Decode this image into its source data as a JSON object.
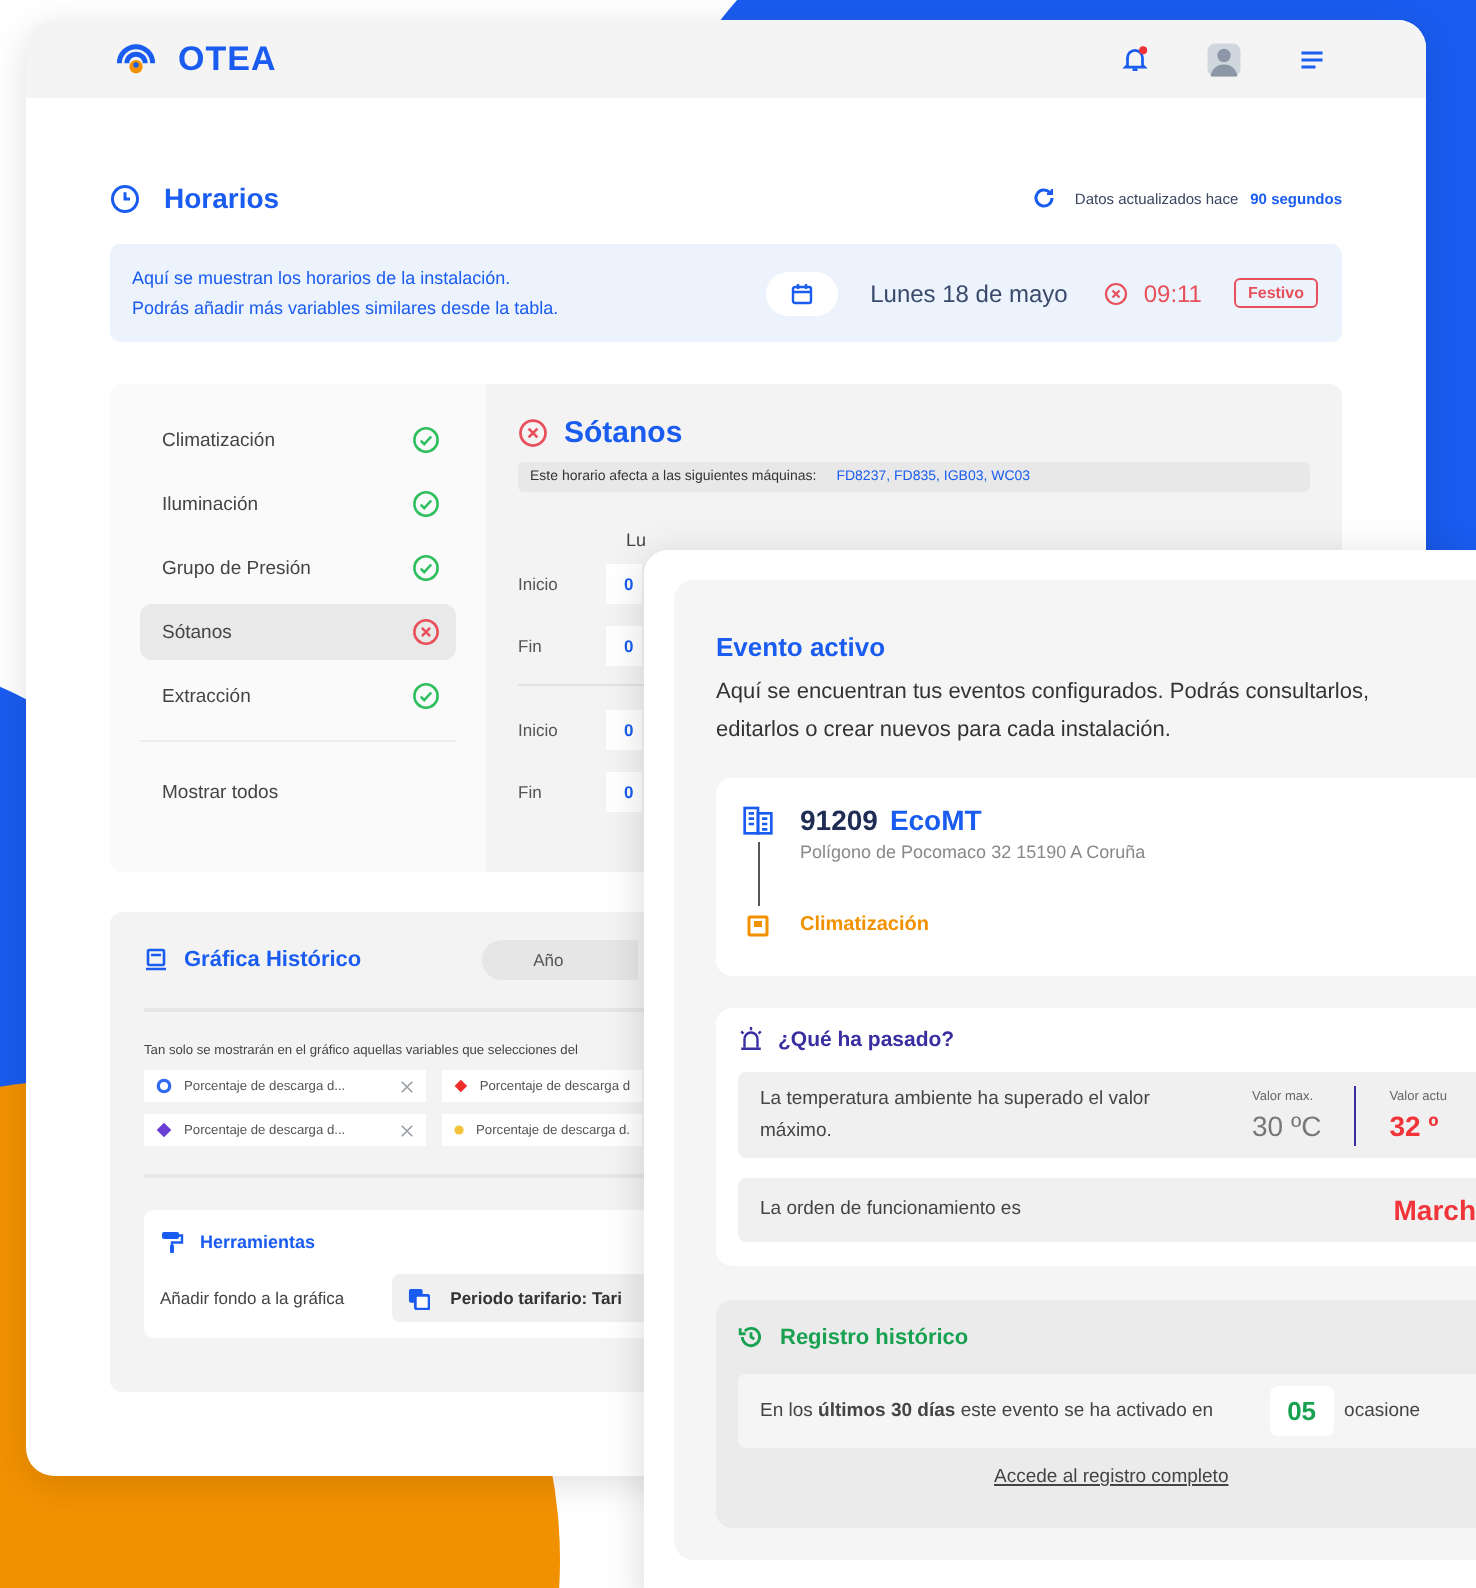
{
  "app_window": {
    "brand": "OTEA",
    "notifications": {
      "unread": true
    }
  },
  "section": {
    "title": "Horarios",
    "updated_label": "Datos actualizados hace",
    "updated_value": "90 segundos"
  },
  "banner": {
    "lines": [
      "Aquí se muestran los horarios de la instalación.",
      "Podrás añadir más variables similares desde la tabla."
    ],
    "date": "Lunes 18 de mayo",
    "time": "09:11",
    "tag": "Festivo"
  },
  "schedules": {
    "items": [
      {
        "label": "Climatización",
        "alert": false,
        "selected": false
      },
      {
        "label": "Iluminación",
        "alert": false,
        "selected": false
      },
      {
        "label": "Grupo de Presión",
        "alert": false,
        "selected": false
      },
      {
        "label": "Sótanos",
        "alert": true,
        "selected": true
      },
      {
        "label": "Extracción",
        "alert": false,
        "selected": false
      }
    ],
    "show_all": "Mostrar todos",
    "detail": {
      "title": "Sótanos",
      "alert": true,
      "machines_label": "Este horario afecta a las siguientes máquinas:",
      "machines": "FD8237, FD835, IGB03, WC03",
      "days": [
        "Lu"
      ],
      "groups": [
        [
          {
            "label": "Inicio",
            "value": "0"
          },
          {
            "label": "Fin",
            "value": "0"
          }
        ],
        [
          {
            "label": "Inicio",
            "value": "0"
          },
          {
            "label": "Fin",
            "value": "0"
          }
        ]
      ]
    }
  },
  "chart_panel": {
    "title": "Gráfica Histórico",
    "periods": [
      {
        "label": "Año",
        "selected": false
      }
    ],
    "note": "Tan solo se mostrarán en el gráfico aquellas variables que selecciones del",
    "variables": [
      {
        "label": "Porcentaje de descarga d...",
        "kind": "ring",
        "color": "#2f6bf0",
        "removable": true
      },
      {
        "label": "Porcentaje de descarga d",
        "kind": "diamond",
        "color": "#f02b2b",
        "removable": false
      },
      {
        "label": "Porcentaje de descarga d...",
        "kind": "diamond",
        "color": "#6a3fd6",
        "removable": true
      },
      {
        "label": "Porcentaje de descarga d.",
        "kind": "dot",
        "color": "#f2c23a",
        "removable": false
      }
    ],
    "tools": {
      "title": "Herramientas",
      "label": "Añadir fondo a la gráfica",
      "option": "Periodo tarifario: Tari"
    }
  },
  "event_window": {
    "title": "Evento activo",
    "description": "Aquí se encuentran tus eventos configurados. Podrás consultarlos, editarlos o crear nuevos para cada instalación.",
    "site": {
      "code": "91209",
      "name": "EcoMT",
      "address": "Polígono de Pocomaco 32 15190 A Coruña",
      "system": "Climatización"
    },
    "what_happened": {
      "title": "¿Qué ha pasado?",
      "rows": [
        {
          "kind": "reading",
          "text": "La temperatura ambiente ha superado el valor máximo.",
          "max_label": "Valor max.",
          "max_value": "30 ºC",
          "current_label": "Valor actu",
          "current_value": "32 º"
        },
        {
          "kind": "order",
          "text": "La orden de funcionamiento es",
          "value": "March"
        }
      ]
    },
    "history": {
      "title": "Registro histórico",
      "sentence": "En los **últimos 30 días** este evento se ha activado en",
      "count": "05",
      "unit": "ocasione",
      "link": "Accede al registro completo"
    }
  }
}
